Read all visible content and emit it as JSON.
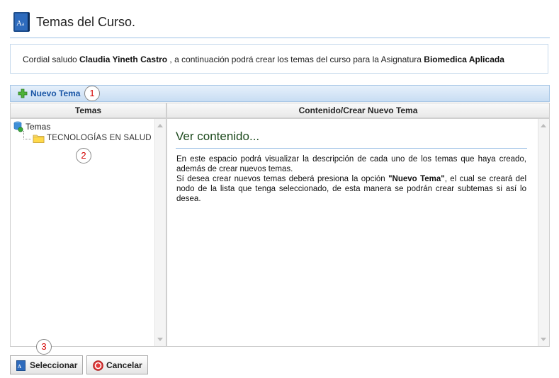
{
  "header": {
    "title": "Temas del Curso.",
    "icon": "book-icon"
  },
  "greeting": {
    "prefix": "Cordial saludo ",
    "user_name": "Claudia Yineth Castro",
    "middle": " , a continuación podrá crear los temas del curso para la Asignatura ",
    "subject": "Biomedica Aplicada"
  },
  "toolbar": {
    "new_topic_label": "Nuevo Tema",
    "icon": "plus-icon"
  },
  "callouts": [
    "1",
    "2",
    "3"
  ],
  "tree": {
    "header": "Temas",
    "root_label": "Temas",
    "nodes": [
      {
        "label": "TECNOLOGÍAS EN SALUD"
      }
    ]
  },
  "content": {
    "header": "Contenido/Crear Nuevo Tema",
    "title": "Ver contenido...",
    "paragraph1": "En este espacio podrá visualizar la descripción de cada uno de los temas que haya creado, además de crear nuevos temas.",
    "paragraph2_start": "Sí desea crear nuevos temas deberá presiona la opción ",
    "paragraph2_bold": "\"Nuevo Tema\"",
    "paragraph2_end": ", el cual se creará del nodo de la lista que tenga seleccionado, de esta manera se podrán crear subtemas si así lo desea."
  },
  "buttons": {
    "select_label": "Seleccionar",
    "cancel_label": "Cancelar"
  },
  "colors": {
    "accent": "#1a56a6",
    "callout": "#d40000",
    "toolbar": "#c8ddf3"
  }
}
